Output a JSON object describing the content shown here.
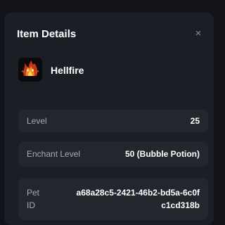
{
  "modal": {
    "title": "Item Details",
    "close_label": "×"
  },
  "item": {
    "name": "Hellfire",
    "icon": "flaming-creature-icon"
  },
  "details": [
    {
      "label": "Level",
      "value": "25"
    },
    {
      "label": "Enchant Level",
      "value": "50 (Bubble Potion)"
    },
    {
      "label": "Pet ID",
      "value": "a68a28c5-2421-46b2-bd5a-6c0fc1cd318b"
    }
  ],
  "colors": {
    "background": "#121318",
    "panel": "#1c1e25",
    "row": "#24262e",
    "label": "#a7abb5",
    "text": "#ffffff"
  }
}
